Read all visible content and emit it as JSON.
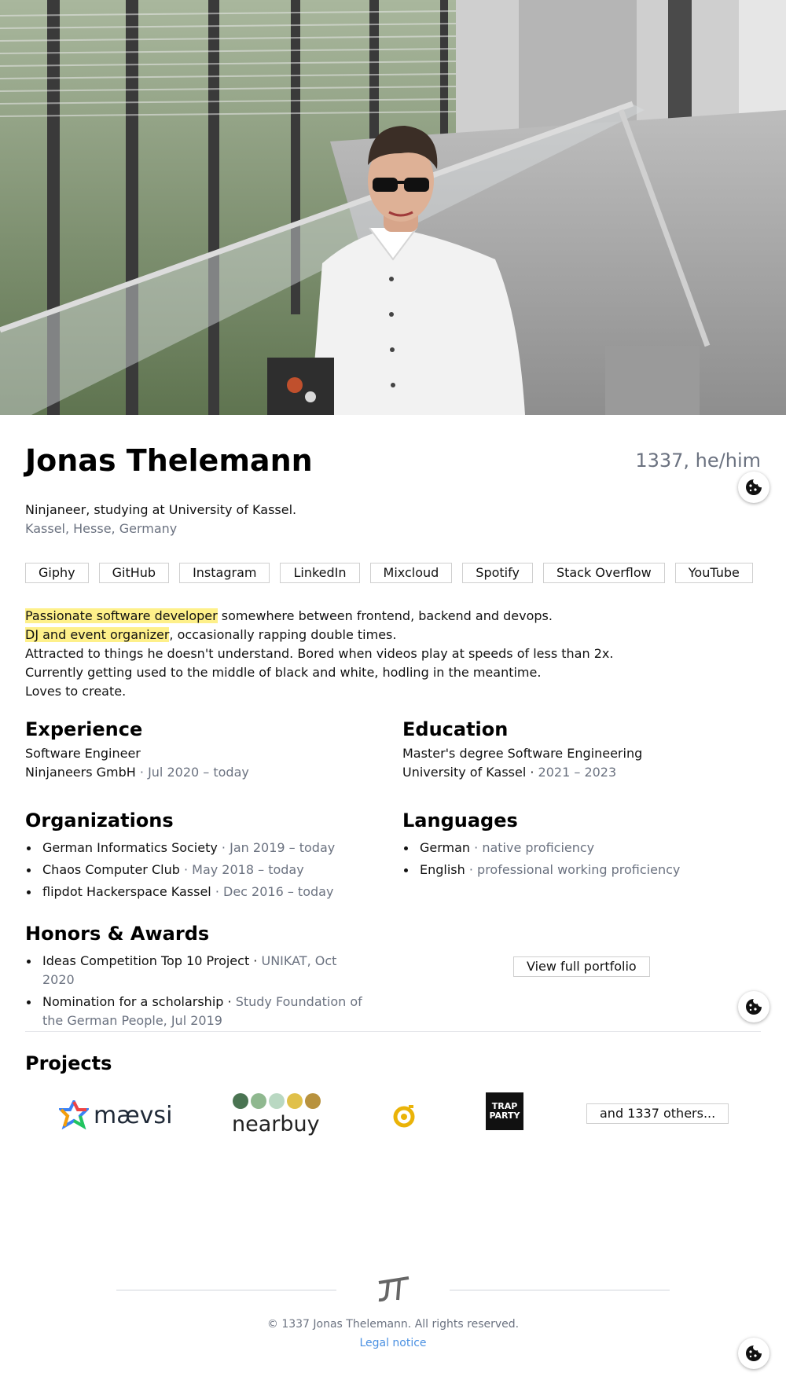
{
  "hero": {
    "alt": "Portrait photo"
  },
  "profile": {
    "name": "Jonas Thelemann",
    "pronouns": "1337, he/him",
    "tagline": "Ninjaneer, studying at University of Kassel.",
    "location": "Kassel, Hesse, Germany"
  },
  "links": [
    "Giphy",
    "GitHub",
    "Instagram",
    "LinkedIn",
    "Mixcloud",
    "Spotify",
    "Stack Overflow",
    "YouTube"
  ],
  "bio": {
    "line1_highlight": "Passionate software developer",
    "line1_rest": " somewhere between frontend, backend and devops.",
    "line2_highlight": "DJ and event organizer",
    "line2_rest": ", occasionally rapping double times.",
    "line3": "Attracted to things he doesn't understand. Bored when videos play at speeds of less than 2x.",
    "line4": "Currently getting used to the middle of black and white, hodling in the meantime.",
    "line5": "Loves to create."
  },
  "experience": {
    "title": "Experience",
    "role": "Software Engineer",
    "company": "Ninjaneers GmbH",
    "period": " · Jul 2020 – today"
  },
  "education": {
    "title": "Education",
    "degree": "Master's degree Software Engineering",
    "school": "University of Kassel",
    "separator": " · ",
    "period": "2021 – 2023"
  },
  "organizations": {
    "title": "Organizations",
    "items": [
      {
        "name": "German Informatics Society",
        "period": " · Jan 2019 – today"
      },
      {
        "name": "Chaos Computer Club",
        "period": " · May 2018 – today"
      },
      {
        "name": "flipdot Hackerspace Kassel",
        "period": " · Dec 2016 – today"
      }
    ]
  },
  "languages": {
    "title": "Languages",
    "items": [
      {
        "name": "German",
        "level": " · native proficiency"
      },
      {
        "name": "English",
        "level": " · professional working proficiency"
      }
    ]
  },
  "honors": {
    "title": "Honors & Awards",
    "items": [
      {
        "name": "Ideas Competition Top 10 Project",
        "sep": " · ",
        "detail": "UNIKAT, Oct 2020"
      },
      {
        "name": "Nomination for a scholarship",
        "sep": " · ",
        "detail": "Study Foundation of the German People, Jul 2019"
      }
    ]
  },
  "portfolio_button": "View full portfolio",
  "projects": {
    "title": "Projects",
    "logos": [
      "maevsi-logo",
      "nearbuy-logo",
      "gelbe-seite-logo",
      "trap-party-logo"
    ],
    "maevsi_text": "mævsi",
    "nearbuy_text": "nearbuy",
    "trap_text_1": "TRAP",
    "trap_text_2": "PARTY",
    "others_button": "and 1337 others..."
  },
  "footer": {
    "logo_text": "JT",
    "copyright": "© 1337 Jonas Thelemann. All rights reserved.",
    "legal": "Legal notice"
  },
  "colors": {
    "highlight": "#fef08a",
    "muted": "#6b7280",
    "link": "#4a90e2"
  }
}
